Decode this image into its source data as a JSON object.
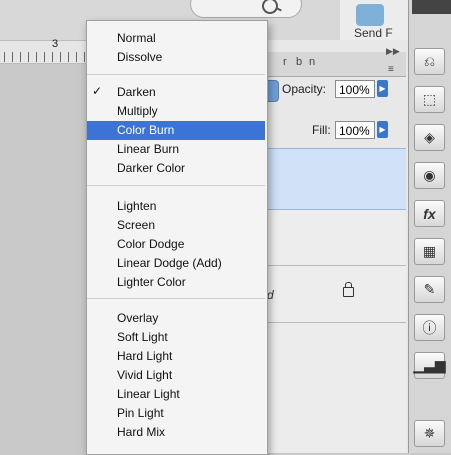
{
  "background": {
    "search_icon": "magnifier-icon",
    "send_label": "Send F",
    "ruler_number": "3"
  },
  "layers_panel": {
    "tab_letters": [
      "r",
      "b",
      "n"
    ],
    "opacity_label": "Opacity:",
    "opacity_value": "100%",
    "fill_label": "Fill:",
    "fill_value": "100%",
    "layer_name_fragment": "d"
  },
  "blend_menu": {
    "selected": "Color Burn",
    "checked": "Darken",
    "groups": [
      [
        "Normal",
        "Dissolve"
      ],
      [
        "Darken",
        "Multiply",
        "Color Burn",
        "Linear Burn",
        "Darker Color"
      ],
      [
        "Lighten",
        "Screen",
        "Color Dodge",
        "Linear Dodge (Add)",
        "Lighter Color"
      ],
      [
        "Overlay",
        "Soft Light",
        "Hard Light",
        "Vivid Light",
        "Linear Light",
        "Pin Light",
        "Hard Mix"
      ]
    ]
  },
  "toolbar": {
    "icons": [
      "history-icon",
      "transform-icon",
      "layers-icon",
      "channels-icon",
      "fx-styles-icon",
      "swatches-icon",
      "brushes-icon",
      "info-icon",
      "histogram-icon",
      "navigator-icon"
    ]
  },
  "colors": {
    "selection": "#3c74d6",
    "layer_selected": "#cfe0f7",
    "menu_bg": "#f4f4f4"
  }
}
